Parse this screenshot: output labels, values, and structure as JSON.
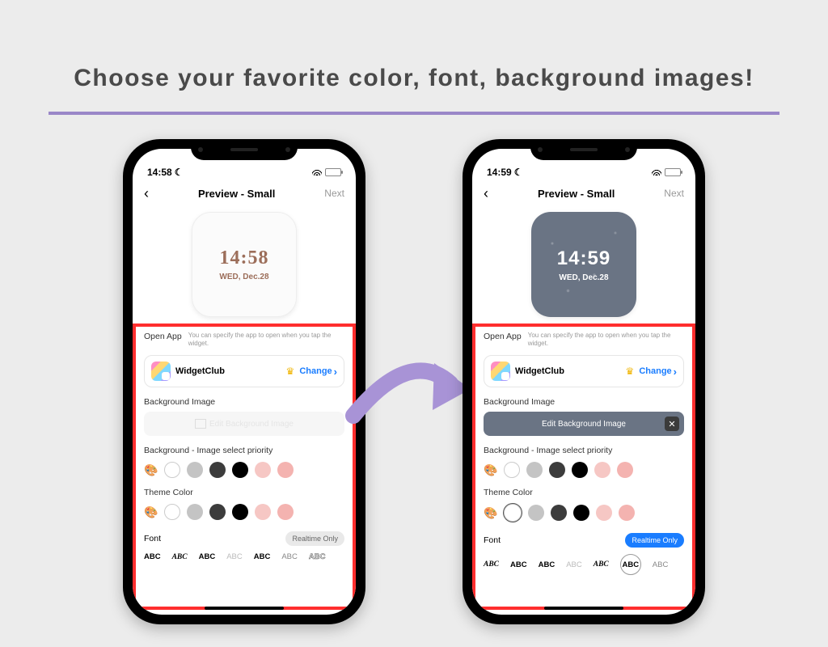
{
  "headline": "Choose your favorite color, font, background images!",
  "common": {
    "nav_title": "Preview - Small",
    "nav_next": "Next",
    "open_app_label": "Open App",
    "open_app_desc": "You can specify the app to open when you tap the widget.",
    "app_name": "WidgetClub",
    "change_label": "Change",
    "section_bg_image": "Background Image",
    "edit_bg_label": "Edit Background Image",
    "section_bg_priority": "Background - Image select priority",
    "section_theme_color": "Theme Color",
    "section_font": "Font",
    "realtime_only": "Realtime Only",
    "font_sample": "ABC"
  },
  "phone_left": {
    "status_time": "14:58",
    "widget_time": "14:58",
    "widget_date": "WED, Dec.28"
  },
  "phone_right": {
    "status_time": "14:59",
    "widget_time": "14:59",
    "widget_date": "WED, Dec.28"
  }
}
